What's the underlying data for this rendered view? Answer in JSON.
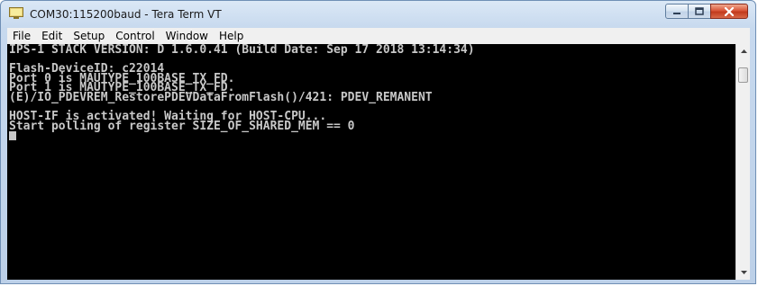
{
  "window": {
    "title": "COM30:115200baud - Tera Term VT",
    "minimize_icon": "minimize-icon",
    "maximize_icon": "maximize-icon",
    "close_icon": "close-icon"
  },
  "menu": {
    "items": [
      "File",
      "Edit",
      "Setup",
      "Control",
      "Window",
      "Help"
    ]
  },
  "terminal": {
    "lines": [
      "IPS-1 STACK VERSION: D 1.6.0.41 (Build Date: Sep 17 2018 13:14:34)",
      "",
      "Flash-DeviceID: c22014",
      "Port 0 is MAUTYPE_100BASE_TX_FD.",
      "Port 1 is MAUTYPE_100BASE_TX_FD.",
      "(E)/IO_PDEVREM_RestorePDEVDataFromFlash()/421: PDEV_REMANENT",
      "",
      "HOST-IF is activated! Waiting for HOST-CPU...",
      "Start polling of register SIZE_OF_SHARED_MEM == 0"
    ]
  },
  "scrollbar": {
    "up_icon": "scroll-up-arrow-icon",
    "down_icon": "scroll-down-arrow-icon"
  }
}
